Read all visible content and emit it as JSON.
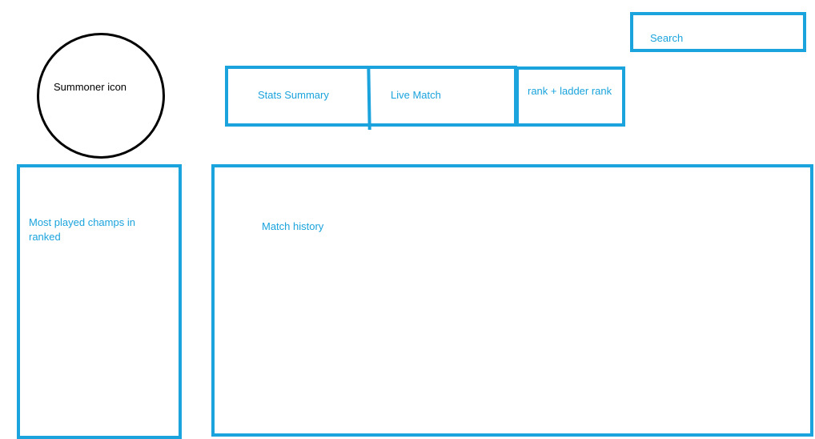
{
  "header": {
    "search_label": "Search"
  },
  "profile": {
    "avatar_label": "Summoner icon",
    "tabs": [
      {
        "label": "Stats Summary"
      },
      {
        "label": "Live Match"
      }
    ],
    "rank_label": "rank + ladder rank"
  },
  "sidebar": {
    "most_played_label": "Most played champs in ranked"
  },
  "main": {
    "match_history_label": "Match history"
  },
  "colors": {
    "accent": "#1aa3dc",
    "outline": "#000000"
  }
}
